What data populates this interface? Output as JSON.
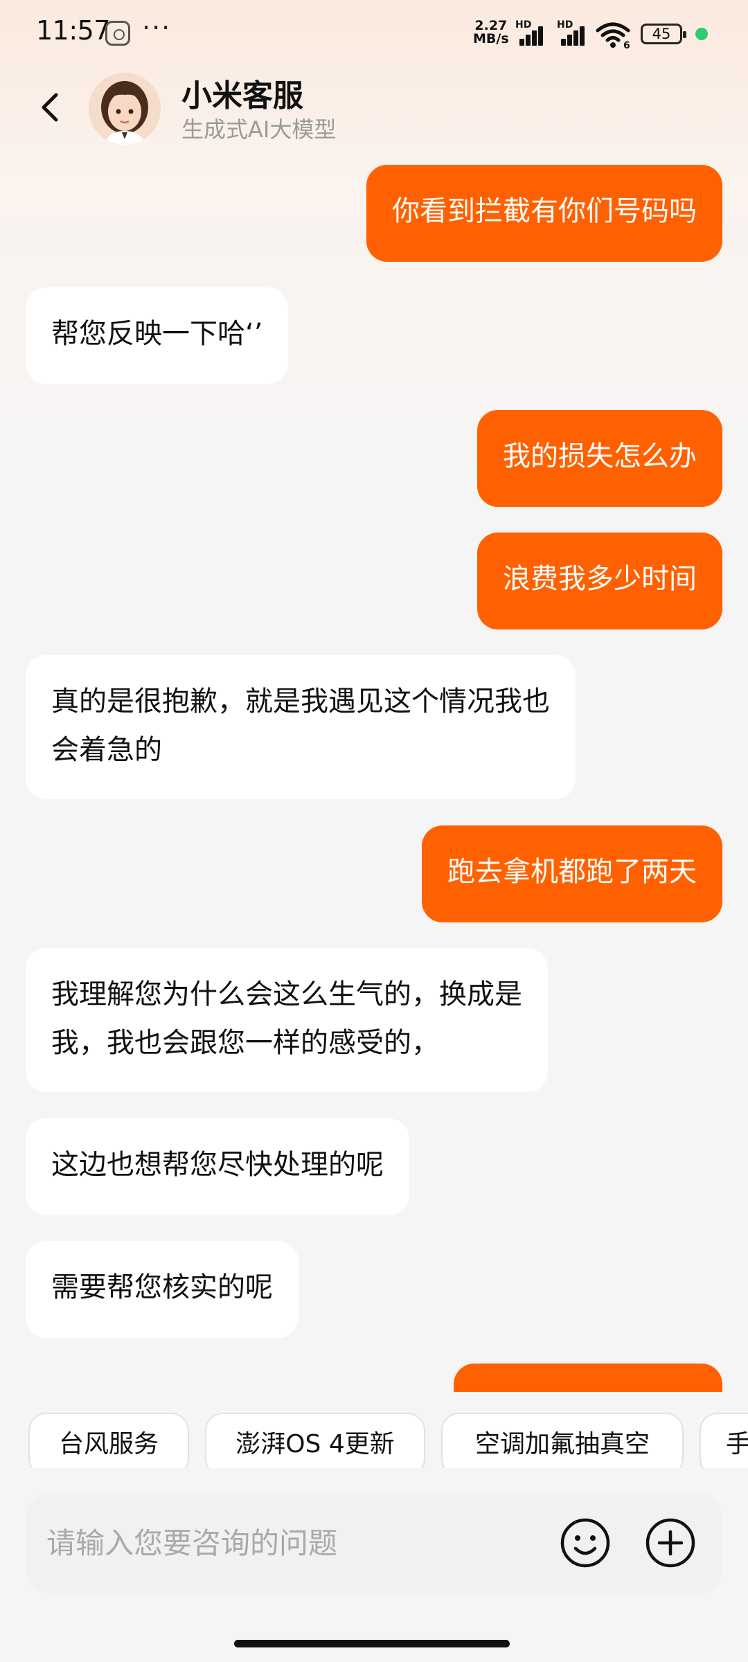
{
  "status_bar": {
    "time": "11:57",
    "more": "···",
    "net_speed_value": "2.27",
    "net_speed_unit": "MB/s",
    "signal1_label": "HD",
    "signal2_label": "HD",
    "wifi_badge": "6",
    "battery": "45",
    "dot_color": "#2ecc71"
  },
  "header": {
    "title": "小米客服",
    "subtitle": "生成式AI大模型"
  },
  "messages": [
    {
      "role": "user",
      "text": "你看到拦截有你们号码吗"
    },
    {
      "role": "bot",
      "text": "帮您反映一下哈‘’"
    },
    {
      "role": "user",
      "text": "我的损失怎么办"
    },
    {
      "role": "user",
      "text": "浪费我多少时间"
    },
    {
      "role": "bot",
      "text": "真的是很抱歉，就是我遇见这个情况我也\n会着急的"
    },
    {
      "role": "user",
      "text": "跑去拿机都跑了两天"
    },
    {
      "role": "bot",
      "text": "我理解您为什么会这么生气的，换成是\n我，我也会跟您一样的感受的，"
    },
    {
      "role": "bot",
      "text": "这边也想帮您尽快处理的呢"
    },
    {
      "role": "bot",
      "text": "需要帮您核实的呢"
    },
    {
      "role": "user",
      "text": ""
    }
  ],
  "quick_replies": [
    "台风服务",
    "澎湃OS 4更新",
    "空调加氟抽真空",
    "手"
  ],
  "input": {
    "placeholder": "请输入您要咨询的问题"
  },
  "icons": {
    "back": "chevron-left-icon",
    "emoji": "smile-icon",
    "add": "plus-circle-icon"
  },
  "colors": {
    "user_bubble": "#ff6100",
    "bot_bubble": "#ffffff",
    "accent": "#ff6100"
  }
}
